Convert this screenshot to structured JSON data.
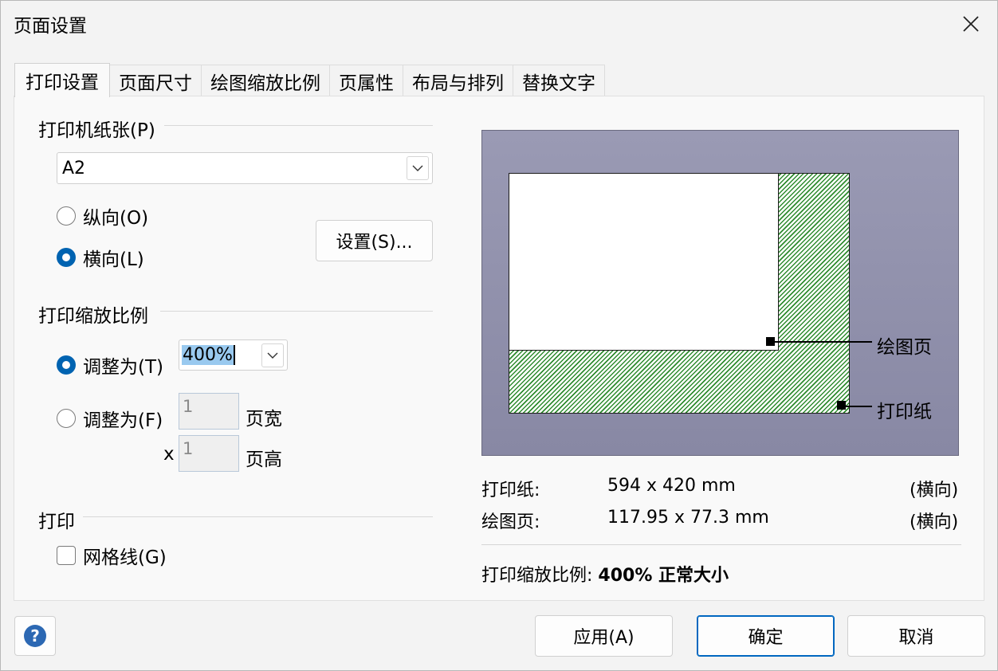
{
  "dialog": {
    "title": "页面设置"
  },
  "tabs": [
    {
      "label": "打印设置"
    },
    {
      "label": "页面尺寸"
    },
    {
      "label": "绘图缩放比例"
    },
    {
      "label": "页属性"
    },
    {
      "label": "布局与排列"
    },
    {
      "label": "替换文字"
    }
  ],
  "printer_paper": {
    "group_label": "打印机纸张(P)",
    "paper_size": "A2",
    "portrait_label": "纵向(O)",
    "landscape_label": "横向(L)",
    "orientation_selected": "landscape",
    "setup_button": "设置(S)..."
  },
  "print_zoom": {
    "group_label": "打印缩放比例",
    "adjust_to_label": "调整为(T)",
    "adjust_to_value": "400%",
    "fit_to_label": "调整为(F)",
    "fit_width_value": "1",
    "fit_width_unit": "页宽",
    "x_label": "x",
    "fit_height_value": "1",
    "fit_height_unit": "页高",
    "selected": "adjust_to"
  },
  "print": {
    "group_label": "打印",
    "gridlines_label": "网格线(G)",
    "gridlines_checked": false
  },
  "preview": {
    "drawing_page_label": "绘图页",
    "print_paper_label": "打印纸"
  },
  "info": {
    "paper_label": "打印纸:",
    "paper_size": "594 x 420 mm",
    "paper_orientation": "(横向)",
    "drawing_label": "绘图页:",
    "drawing_size": "117.95 x 77.3 mm",
    "drawing_orientation": "(横向)",
    "zoom_label": "打印缩放比例:",
    "zoom_value": "400% 正常大小"
  },
  "footer": {
    "apply_button": "应用(A)",
    "ok_button": "确定",
    "cancel_button": "取消"
  },
  "colors": {
    "accent": "#0063b1",
    "preview_background": "#9090aa",
    "hatch": "#2e8b2e"
  }
}
